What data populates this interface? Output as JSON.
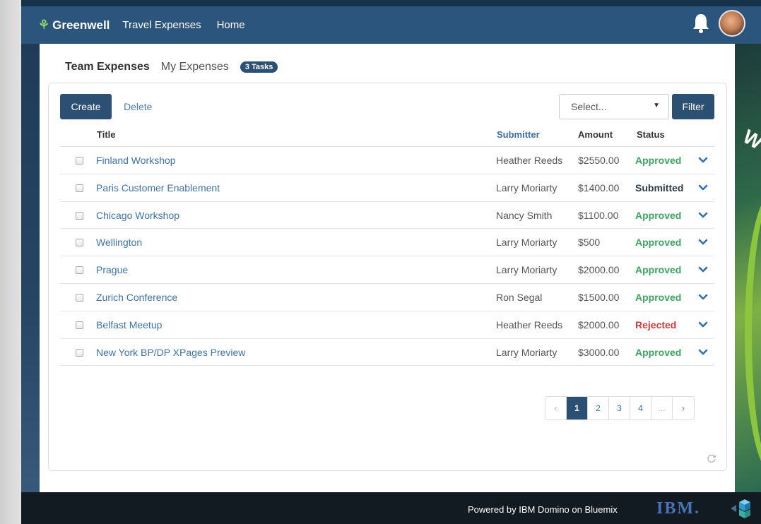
{
  "header": {
    "brand": "Greenwell",
    "nav": {
      "travel_expenses": "Travel Expenses",
      "home": "Home"
    }
  },
  "tabs": {
    "team_expenses": "Team Expenses",
    "my_expenses": "My Expenses",
    "tasks_badge": "3 Tasks"
  },
  "toolbar": {
    "create_label": "Create",
    "delete_label": "Delete",
    "select_placeholder": "Select...",
    "filter_label": "Filter"
  },
  "table": {
    "columns": {
      "title": "Title",
      "submitter": "Submitter",
      "amount": "Amount",
      "status": "Status"
    },
    "rows": [
      {
        "title": "Finland Workshop",
        "submitter": "Heather Reeds",
        "amount": "$2550.00",
        "status": "Approved"
      },
      {
        "title": "Paris Customer Enablement",
        "submitter": "Larry Moriarty",
        "amount": "$1400.00",
        "status": "Submitted"
      },
      {
        "title": "Chicago Workshop",
        "submitter": "Nancy Smith",
        "amount": "$1100.00",
        "status": "Approved"
      },
      {
        "title": "Wellington",
        "submitter": "Larry Moriarty",
        "amount": "$500",
        "status": "Approved"
      },
      {
        "title": "Prague",
        "submitter": "Larry Moriarty",
        "amount": "$2000.00",
        "status": "Approved"
      },
      {
        "title": "Zurich Conference",
        "submitter": "Ron Segal",
        "amount": "$1500.00",
        "status": "Approved"
      },
      {
        "title": "Belfast Meetup",
        "submitter": "Heather Reeds",
        "amount": "$2000.00",
        "status": "Rejected"
      },
      {
        "title": "New York BP/DP XPages Preview",
        "submitter": "Larry Moriarty",
        "amount": "$3000.00",
        "status": "Approved"
      }
    ]
  },
  "pagination": {
    "prev": "‹",
    "pages": [
      "1",
      "2",
      "3",
      "4"
    ],
    "ellipsis": "...",
    "next": "›",
    "current": "1"
  },
  "footer": {
    "powered_by": "Powered by IBM Domino on Bluemix",
    "ibm_logo": "IBM."
  },
  "colors": {
    "header_bg": "#2b557d",
    "primary_button": "#2c4f74",
    "approved": "#3aa560",
    "rejected": "#cf3b3b",
    "submitted": "#2f3c48",
    "link": "#3d73ad"
  },
  "icons": {
    "brand": "leaf-icon",
    "notifications": "bell-icon",
    "row_expand": "chevron-down-icon",
    "refresh": "refresh-icon",
    "bluemix": "bluemix-cube-icon"
  }
}
